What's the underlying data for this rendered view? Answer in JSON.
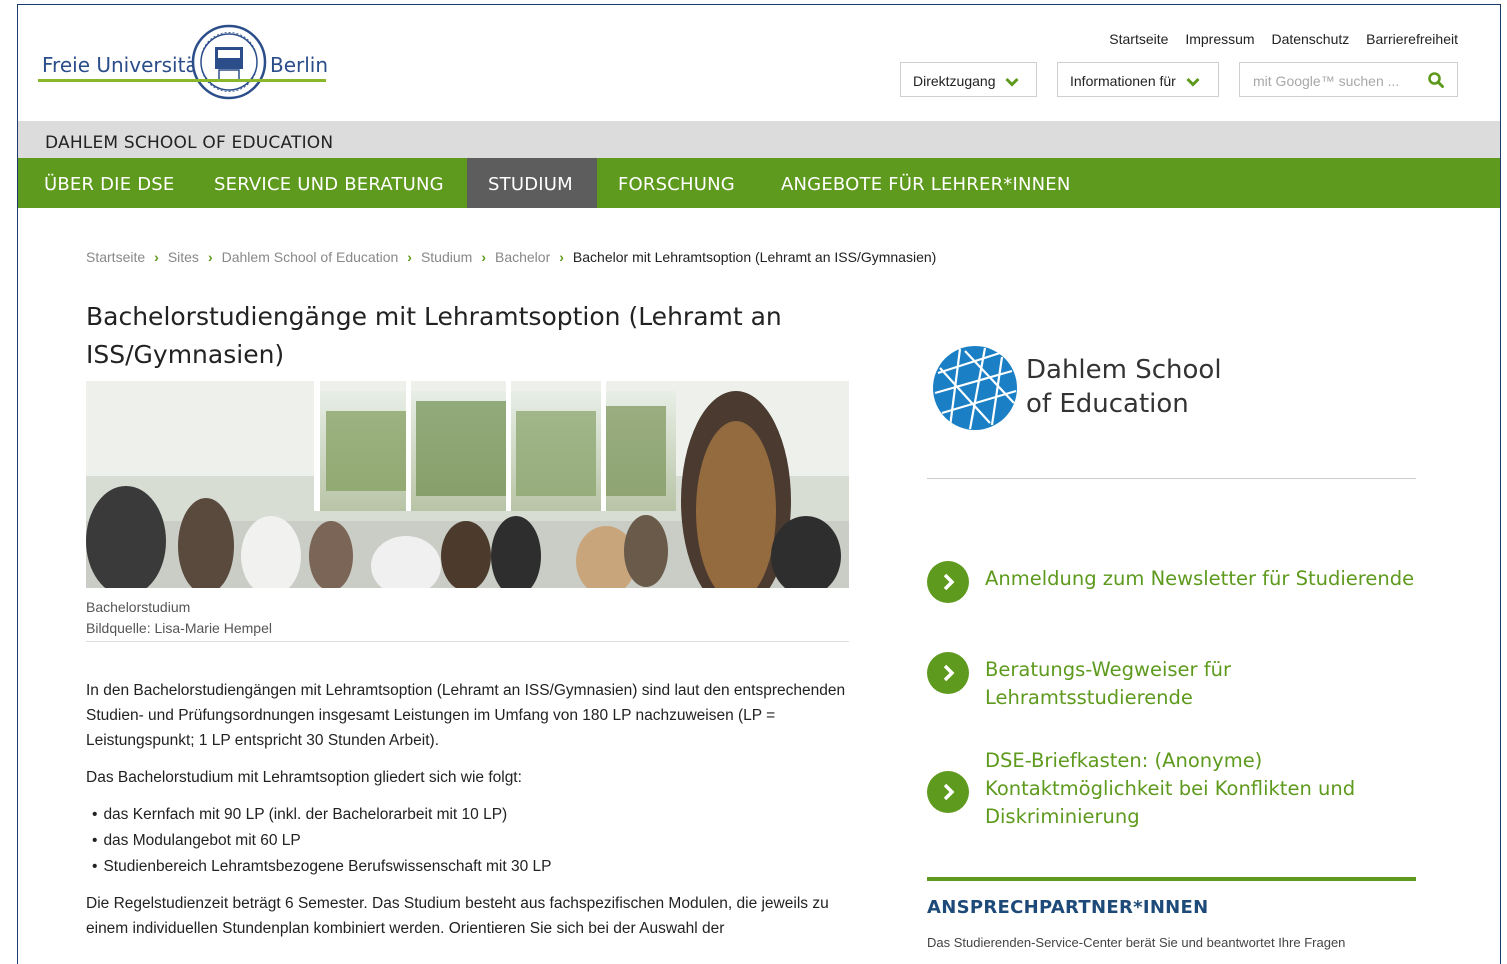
{
  "header": {
    "logo_left": "Freie Universität",
    "logo_right": "Berlin",
    "service_links": [
      "Startseite",
      "Impressum",
      "Datenschutz",
      "Barrierefreiheit"
    ],
    "direktzugang": "Direktzugang",
    "informationen": "Informationen für",
    "search_placeholder": "mit Google™ suchen ..."
  },
  "institute": "DAHLEM SCHOOL OF EDUCATION",
  "nav": [
    "ÜBER DIE DSE",
    "SERVICE UND BERATUNG",
    "STUDIUM",
    "FORSCHUNG",
    "ANGEBOTE FÜR LEHRER*INNEN"
  ],
  "breadcrumb": [
    "Startseite",
    "Sites",
    "Dahlem School of Education",
    "Studium",
    "Bachelor",
    "Bachelor mit Lehramtsoption (Lehramt an ISS/Gymnasien)"
  ],
  "main": {
    "title": "Bachelorstudiengänge mit Lehramtsoption (Lehramt an ISS/Gymnasien)",
    "caption_title": "Bachelorstudium",
    "caption_source": "Bildquelle: Lisa-Marie Hempel",
    "p1": "In den Bachelorstudiengängen mit Lehramtsoption (Lehramt an ISS/Gymnasien) sind laut den entsprechenden Studien- und Prüfungsordnungen insgesamt Leistungen im Umfang von 180 LP nachzuweisen (LP = Leistungspunkt; 1 LP entspricht 30 Stunden Arbeit).",
    "p2": "Das Bachelorstudium mit Lehramtsoption gliedert sich wie folgt:",
    "list": [
      "das Kernfach mit 90 LP (inkl. der Bachelorarbeit mit 10 LP)",
      "das Modulangebot mit 60 LP",
      "Studienbereich Lehramtsbezogene Berufswissenschaft mit 30 LP"
    ],
    "p3": "Die Regelstudienzeit beträgt 6 Semester. Das Studium besteht aus fachspezifischen Modulen, die jeweils zu einem individuellen Stundenplan kombiniert werden. Orientieren Sie sich bei der Auswahl der"
  },
  "sidebar": {
    "logo_line1": "Dahlem School",
    "logo_line2": "of Education",
    "links": [
      "Anmeldung zum Newsletter für Studierende",
      "Beratungs-Wegweiser für Lehramtsstudierende",
      "DSE-Briefkasten: (Anonyme) Kontaktmöglichkeit bei Konflikten und Diskriminierung"
    ],
    "contact_heading": "ANSPRECHPARTNER*INNEN",
    "contact_text": "Das Studierenden-Service-Center berät Sie und beantwortet Ihre Fragen"
  },
  "colors": {
    "green": "#5e9a1d",
    "nav_active": "#5d5d5d",
    "fu_blue": "#2b4d8a",
    "dse_blue": "#1a7fc4"
  }
}
